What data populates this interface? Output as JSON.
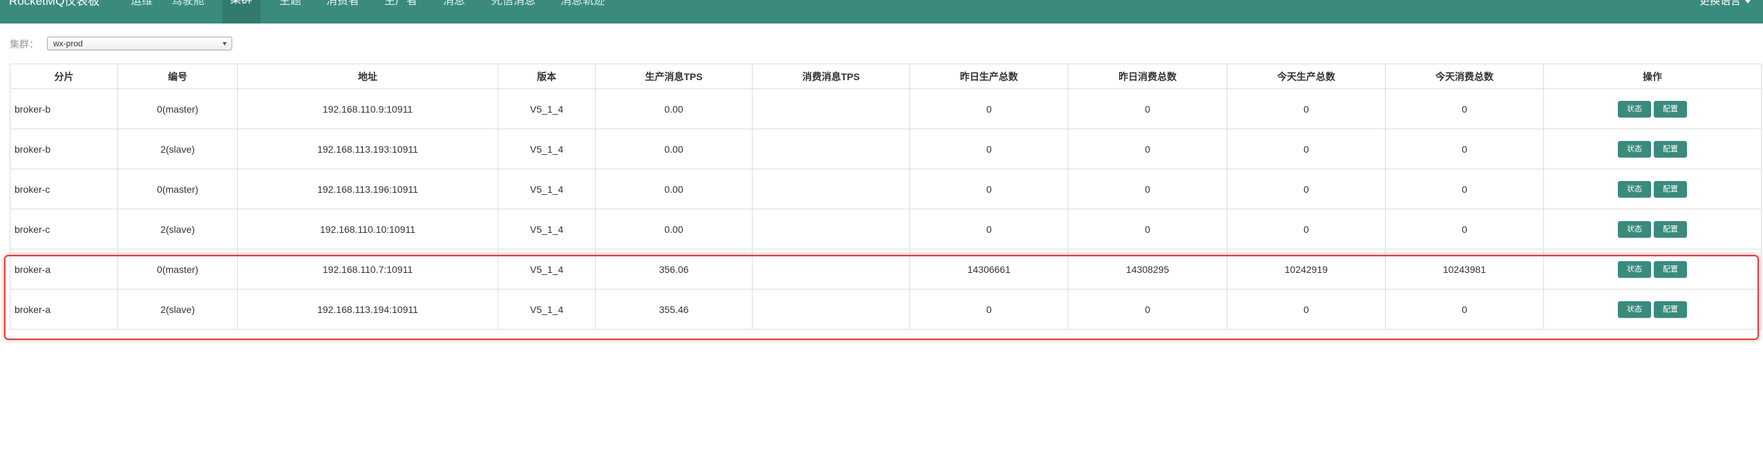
{
  "app": {
    "brand": "RocketMQ仪表板"
  },
  "nav": {
    "items": [
      {
        "label": "运维"
      },
      {
        "label": "驾驶舱"
      },
      {
        "label": "集群"
      },
      {
        "label": "主题"
      },
      {
        "label": "消费者"
      },
      {
        "label": "生产者"
      },
      {
        "label": "消息"
      },
      {
        "label": "死信消息"
      },
      {
        "label": "消息轨迹"
      }
    ],
    "active": "集群",
    "language_label": "更换语言"
  },
  "cluster": {
    "label": "集群：",
    "selected": "wx-prod"
  },
  "table": {
    "headers": [
      "分片",
      "编号",
      "地址",
      "版本",
      "生产消息TPS",
      "消费消息TPS",
      "昨日生产总数",
      "昨日消费总数",
      "今天生产总数",
      "今天消费总数",
      "操作"
    ],
    "action_labels": {
      "status": "状态",
      "config": "配置"
    },
    "rows": [
      {
        "shard": "broker-b",
        "id": "0(master)",
        "address": "192.168.110.9:10911",
        "version": "V5_1_4",
        "produce_tps": "0.00",
        "consume_tps": "",
        "yesterday_produce": "0",
        "yesterday_consume": "0",
        "today_produce": "0",
        "today_consume": "0"
      },
      {
        "shard": "broker-b",
        "id": "2(slave)",
        "address": "192.168.113.193:10911",
        "version": "V5_1_4",
        "produce_tps": "0.00",
        "consume_tps": "",
        "yesterday_produce": "0",
        "yesterday_consume": "0",
        "today_produce": "0",
        "today_consume": "0"
      },
      {
        "shard": "broker-c",
        "id": "0(master)",
        "address": "192.168.113.196:10911",
        "version": "V5_1_4",
        "produce_tps": "0.00",
        "consume_tps": "",
        "yesterday_produce": "0",
        "yesterday_consume": "0",
        "today_produce": "0",
        "today_consume": "0"
      },
      {
        "shard": "broker-c",
        "id": "2(slave)",
        "address": "192.168.110.10:10911",
        "version": "V5_1_4",
        "produce_tps": "0.00",
        "consume_tps": "",
        "yesterday_produce": "0",
        "yesterday_consume": "0",
        "today_produce": "0",
        "today_consume": "0"
      },
      {
        "shard": "broker-a",
        "id": "0(master)",
        "address": "192.168.110.7:10911",
        "version": "V5_1_4",
        "produce_tps": "356.06",
        "consume_tps": "",
        "yesterday_produce": "14306661",
        "yesterday_consume": "14308295",
        "today_produce": "10242919",
        "today_consume": "10243981"
      },
      {
        "shard": "broker-a",
        "id": "2(slave)",
        "address": "192.168.113.194:10911",
        "version": "V5_1_4",
        "produce_tps": "355.46",
        "consume_tps": "",
        "yesterday_produce": "0",
        "yesterday_consume": "0",
        "today_produce": "0",
        "today_consume": "0"
      }
    ]
  },
  "colors": {
    "navbar": "#3a8a7e",
    "button": "#3a8a7e",
    "highlight": "#d9403a"
  }
}
